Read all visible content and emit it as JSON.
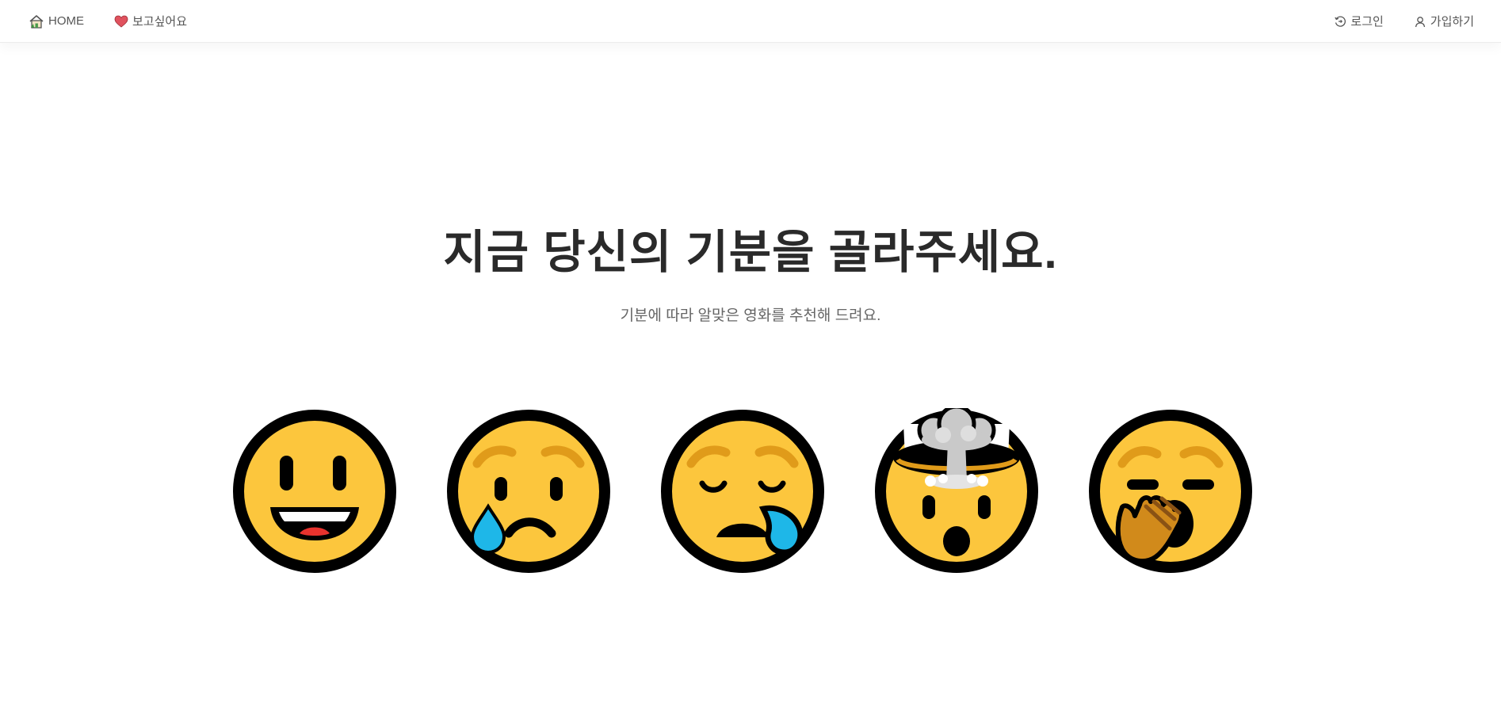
{
  "nav": {
    "home_label": "HOME",
    "wishlist_label": "보고싶어요",
    "login_label": "로그인",
    "signup_label": "가입하기"
  },
  "hero": {
    "title": "지금 당신의 기분을 골라주세요.",
    "subtitle": "기분에 따라 알맞은 영화를 추천해 드려요."
  },
  "moods": [
    {
      "name": "happy",
      "icon": "grinning-face-icon"
    },
    {
      "name": "sad",
      "icon": "sad-tear-face-icon"
    },
    {
      "name": "tired",
      "icon": "sweat-sleepy-face-icon"
    },
    {
      "name": "mind-blown",
      "icon": "exploding-head-icon"
    },
    {
      "name": "bored",
      "icon": "yawning-face-icon"
    }
  ],
  "colors": {
    "face": "#FCC63D",
    "outline": "#000000",
    "accent_brown": "#E09B1A",
    "tear": "#1EB7E8",
    "heart": "#E0525E",
    "title_text": "#2a2a2a",
    "nav_text": "#555555"
  }
}
